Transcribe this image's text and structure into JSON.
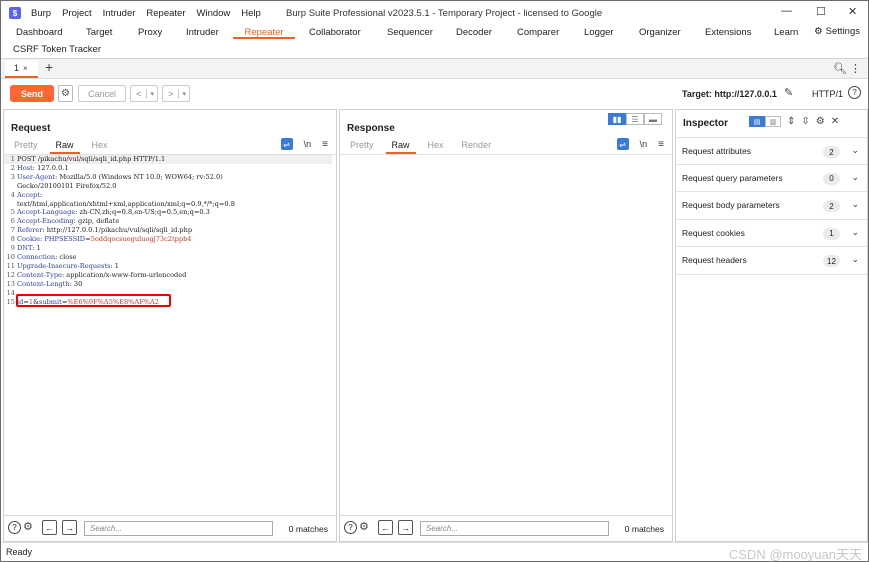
{
  "app": {
    "logo_glyph": "$",
    "menu": [
      "Burp",
      "Project",
      "Intruder",
      "Repeater",
      "Window",
      "Help"
    ],
    "window_title": "Burp Suite Professional v2023.5.1 - Temporary Project - licensed to Google",
    "window_controls": [
      "—",
      "☐",
      "✕"
    ]
  },
  "main_tabs": [
    {
      "label": "Dashboard",
      "active": false
    },
    {
      "label": "Target",
      "active": false
    },
    {
      "label": "Proxy",
      "active": false
    },
    {
      "label": "Intruder",
      "active": false
    },
    {
      "label": "Repeater",
      "active": true
    },
    {
      "label": "Collaborator",
      "active": false
    },
    {
      "label": "Sequencer",
      "active": false
    },
    {
      "label": "Decoder",
      "active": false
    },
    {
      "label": "Comparer",
      "active": false
    },
    {
      "label": "Logger",
      "active": false
    },
    {
      "label": "Organizer",
      "active": false
    },
    {
      "label": "Extensions",
      "active": false
    },
    {
      "label": "Learn",
      "active": false
    }
  ],
  "settings_label": "Settings",
  "csrf_tab": "CSRF Token Tracker",
  "repeater_tab": {
    "label": "1",
    "close": "×"
  },
  "add_tab_glyph": "+",
  "toolbar": {
    "send_label": "Send",
    "cancel_label": "Cancel",
    "target_label": "Target: http://127.0.0.1",
    "http_version": "HTTP/1",
    "help_glyph": "?",
    "prev_glyph": "<",
    "next_glyph": ">",
    "dropdown_glyph": "▾"
  },
  "request": {
    "title": "Request",
    "tabs": [
      "Pretty",
      "Raw",
      "Hex"
    ],
    "active_tab": "Raw",
    "lines": [
      {
        "n": "1",
        "text": "POST /pikachu/vul/sqli/sqli_id.php HTTP/1.1"
      },
      {
        "n": "2",
        "name": "Host",
        "value": "127.0.0.1"
      },
      {
        "n": "3",
        "name": "User-Agent",
        "value": "Mozilla/5.0 (Windows NT 10.0; WOW64; rv:52.0)"
      },
      {
        "n": "",
        "text": "Gecko/20100101 Firefox/52.0"
      },
      {
        "n": "4",
        "name": "Accept",
        "value": ""
      },
      {
        "n": "",
        "text": "text/html,application/xhtml+xml,application/xml;q=0.9,*/*;q=0.8"
      },
      {
        "n": "5",
        "name": "Accept-Language",
        "value": "zh-CN,zh;q=0.8,en-US;q=0.5,en;q=0.3"
      },
      {
        "n": "6",
        "name": "Accept-Encoding",
        "value": "gzip, deflate"
      },
      {
        "n": "7",
        "name": "Referer",
        "value": "http://127.0.0.1/pikachu/vul/sqli/sqli_id.php"
      },
      {
        "n": "8",
        "name": "Cookie",
        "cookie_name": "PHPSESSID",
        "cookie_value": "5oddqocsueguluogj73c2tppb4"
      },
      {
        "n": "9",
        "name": "DNT",
        "value": "1"
      },
      {
        "n": "10",
        "name": "Connection",
        "value": "close"
      },
      {
        "n": "11",
        "name": "Upgrade-Insecure-Requests",
        "value": "1"
      },
      {
        "n": "12",
        "name": "Content-Type",
        "value": "application/x-www-form-urlencoded"
      },
      {
        "n": "13",
        "name": "Content-Length",
        "value": "30"
      },
      {
        "n": "14",
        "text": ""
      },
      {
        "n": "15",
        "body": [
          {
            "k": "id",
            "v": "1"
          },
          {
            "k": "submit",
            "v": "%E6%9F%A5%E8%AF%A2"
          }
        ]
      }
    ]
  },
  "response": {
    "title": "Response",
    "tabs": [
      "Pretty",
      "Raw",
      "Hex",
      "Render"
    ],
    "active_tab": "Raw"
  },
  "search": {
    "placeholder": "Search...",
    "matches": "0 matches"
  },
  "inspector": {
    "title": "Inspector",
    "rows": [
      {
        "label": "Request attributes",
        "count": "2"
      },
      {
        "label": "Request query parameters",
        "count": "0"
      },
      {
        "label": "Request body parameters",
        "count": "2"
      },
      {
        "label": "Request cookies",
        "count": "1"
      },
      {
        "label": "Request headers",
        "count": "12"
      }
    ]
  },
  "status": {
    "text": "Ready",
    "watermark": "CSDN @mooyuan天天"
  },
  "colors": {
    "accent": "#e8632a",
    "send": "#ff6633",
    "highlight_box": "#ee0000",
    "header_name": "#2c3d9e",
    "param_value": "#c0392b"
  }
}
